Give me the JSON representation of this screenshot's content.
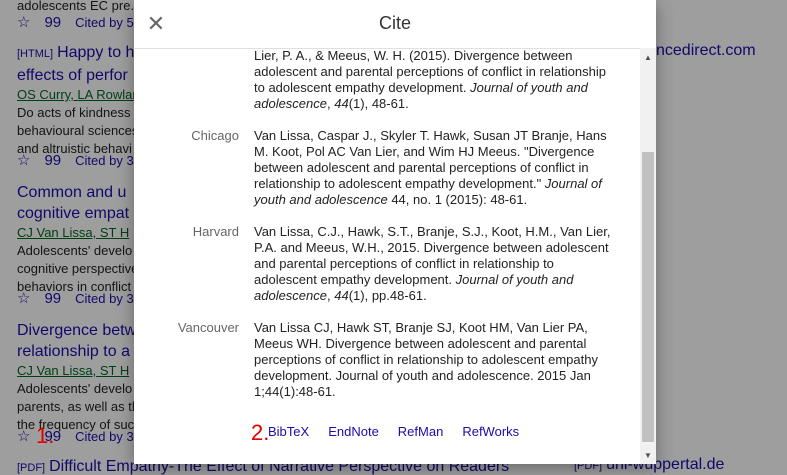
{
  "background": {
    "results": [
      {
        "title_partial": "",
        "authors_partial": "",
        "snippet_lines": [
          "adolescents  EC pre..."
        ],
        "cited_by": "Cited by 5"
      },
      {
        "tag": "[HTML]",
        "title_lines": [
          "Happy to h",
          "effects of perfor"
        ],
        "authors": "OS Curry, LA Rowlar",
        "snippet_lines": [
          "Do acts of kindness",
          "behavioural sciences",
          "and altruistic behavi"
        ],
        "cited_by": "Cited by 3"
      },
      {
        "title_lines": [
          "Common and u",
          "cognitive empat"
        ],
        "authors": "CJ Van Lissa, ST H",
        "snippet_lines": [
          "Adolescents' develo",
          "cognitive perspective",
          "behaviors in conflict"
        ],
        "cited_by": "Cited by 3"
      },
      {
        "title_lines": [
          "Divergence betw",
          "relationship to a"
        ],
        "authors": "CJ Van Lissa, ST H",
        "snippet_lines": [
          "Adolescents' develo",
          "parents, as well as th",
          "the frequency of suc"
        ],
        "cited_by": "Cited by 3"
      }
    ],
    "bottom_result": {
      "tag": "[PDF]",
      "title": "Difficult Empathy-The Effect of Narrative Perspective on Readers'",
      "side_tag": "[PDF]",
      "side_link": "uni-wuppertal.de"
    },
    "side_link_top": "ncedirect.com",
    "star_icon": "☆",
    "quote_icon": "99"
  },
  "modal": {
    "title": "Cite",
    "citations": [
      {
        "style": "",
        "segments": [
          {
            "t": "Lier, P. A., & Meeus, W. H. (2015). Divergence between adolescent and parental perceptions of conflict in relationship to adolescent empathy development. ",
            "i": false
          },
          {
            "t": "Journal of youth and adolescence",
            "i": true
          },
          {
            "t": ", ",
            "i": false
          },
          {
            "t": "44",
            "i": true
          },
          {
            "t": "(1), 48-61.",
            "i": false
          }
        ]
      },
      {
        "style": "Chicago",
        "segments": [
          {
            "t": "Van Lissa, Caspar J., Skyler T. Hawk, Susan JT Branje, Hans M. Koot, Pol AC Van Lier, and Wim HJ Meeus. \"Divergence between adolescent and parental perceptions of conflict in relationship to adolescent empathy development.\" ",
            "i": false
          },
          {
            "t": "Journal of youth and adolescence",
            "i": true
          },
          {
            "t": " 44, no. 1 (2015): 48-61.",
            "i": false
          }
        ]
      },
      {
        "style": "Harvard",
        "segments": [
          {
            "t": "Van Lissa, C.J., Hawk, S.T., Branje, S.J., Koot, H.M., Van Lier, P.A. and Meeus, W.H., 2015. Divergence between adolescent and parental perceptions of conflict in relationship to adolescent empathy development. ",
            "i": false
          },
          {
            "t": "Journal of youth and adolescence",
            "i": true
          },
          {
            "t": ", ",
            "i": false
          },
          {
            "t": "44",
            "i": true
          },
          {
            "t": "(1), pp.48-61.",
            "i": false
          }
        ]
      },
      {
        "style": "Vancouver",
        "segments": [
          {
            "t": "Van Lissa CJ, Hawk ST, Branje SJ, Koot HM, Van Lier PA, Meeus WH. Divergence between adolescent and parental perceptions of conflict in relationship to adolescent empathy development. Journal of youth and adolescence. 2015 Jan 1;44(1):48-61.",
            "i": false
          }
        ]
      }
    ],
    "export_links": [
      "BibTeX",
      "EndNote",
      "RefMan",
      "RefWorks"
    ]
  },
  "annotations": {
    "marker_1": "1.",
    "marker_2": "2."
  },
  "colors": {
    "link": "#1a0dab",
    "annotation": "#e00000",
    "overlay": "rgba(0,0,0,0.38)"
  }
}
